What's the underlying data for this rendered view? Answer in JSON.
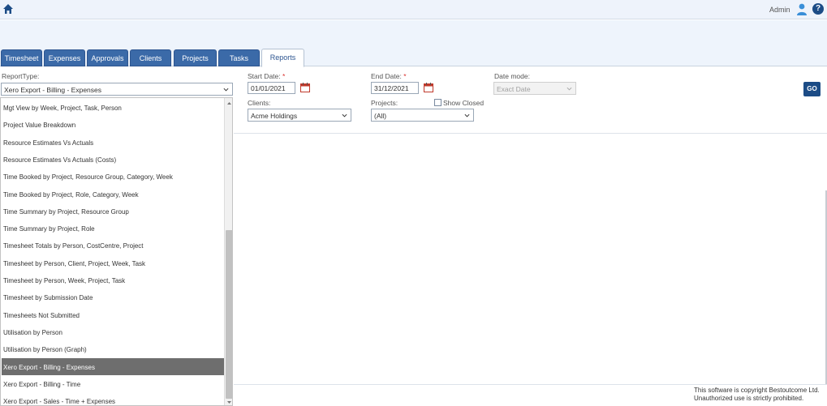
{
  "header": {
    "user_label": "Admin",
    "help_glyph": "?",
    "icons": [
      "home-icon",
      "user-icon",
      "help-icon"
    ]
  },
  "tabs": [
    {
      "label": "Timesheet"
    },
    {
      "label": "Expenses"
    },
    {
      "label": "Approvals"
    },
    {
      "label": "Clients"
    },
    {
      "label": "Projects"
    },
    {
      "label": "Tasks"
    },
    {
      "label": "Reports",
      "active": true
    }
  ],
  "filters": {
    "report_type_label": "ReportType:",
    "report_type_value": "Xero Export - Billing - Expenses",
    "start_date_label": "Start Date:",
    "start_date_value": "01/01/2021",
    "end_date_label": "End Date:",
    "end_date_value": "31/12/2021",
    "required_mark": "*",
    "date_mode_label": "Date mode:",
    "date_mode_value": "Exact Date",
    "clients_label": "Clients:",
    "clients_value": "Acme Holdings",
    "projects_label": "Projects:",
    "projects_value": "(All)",
    "show_closed_label": "Show Closed",
    "show_closed_checked": false,
    "go_label": "GO"
  },
  "report_list": {
    "items": [
      "Mgt View by Week, Project, Task, Person",
      "Project Value Breakdown",
      "Resource Estimates Vs Actuals",
      "Resource Estimates Vs Actuals (Costs)",
      "Time Booked by Project, Resource Group, Category, Week",
      "Time Booked by Project, Role, Category, Week",
      "Time Summary by Project, Resource Group",
      "Time Summary by Project, Role",
      "Timesheet Totals by Person, CostCentre, Project",
      "Timesheet by Person, Client, Project, Week, Task",
      "Timesheet by Person, Week, Project, Task",
      "Timesheet by Submission Date",
      "Timesheets Not Submitted",
      "Utilisation by Person",
      "Utilisation by Person (Graph)",
      "Xero Export - Billing - Expenses",
      "Xero Export - Billing - Time",
      "Xero Export - Sales - Time + Expenses"
    ],
    "selected_index": 15
  },
  "footer": {
    "copyright": "This software is copyright Bestoutcome Ltd.",
    "warning": "Unauthorized use is strictly prohibited."
  },
  "colors": {
    "tab_bg": "#3b6aa8",
    "primary": "#1c4c86",
    "selected_item": "#6e6e6e",
    "required": "#d9302c"
  }
}
